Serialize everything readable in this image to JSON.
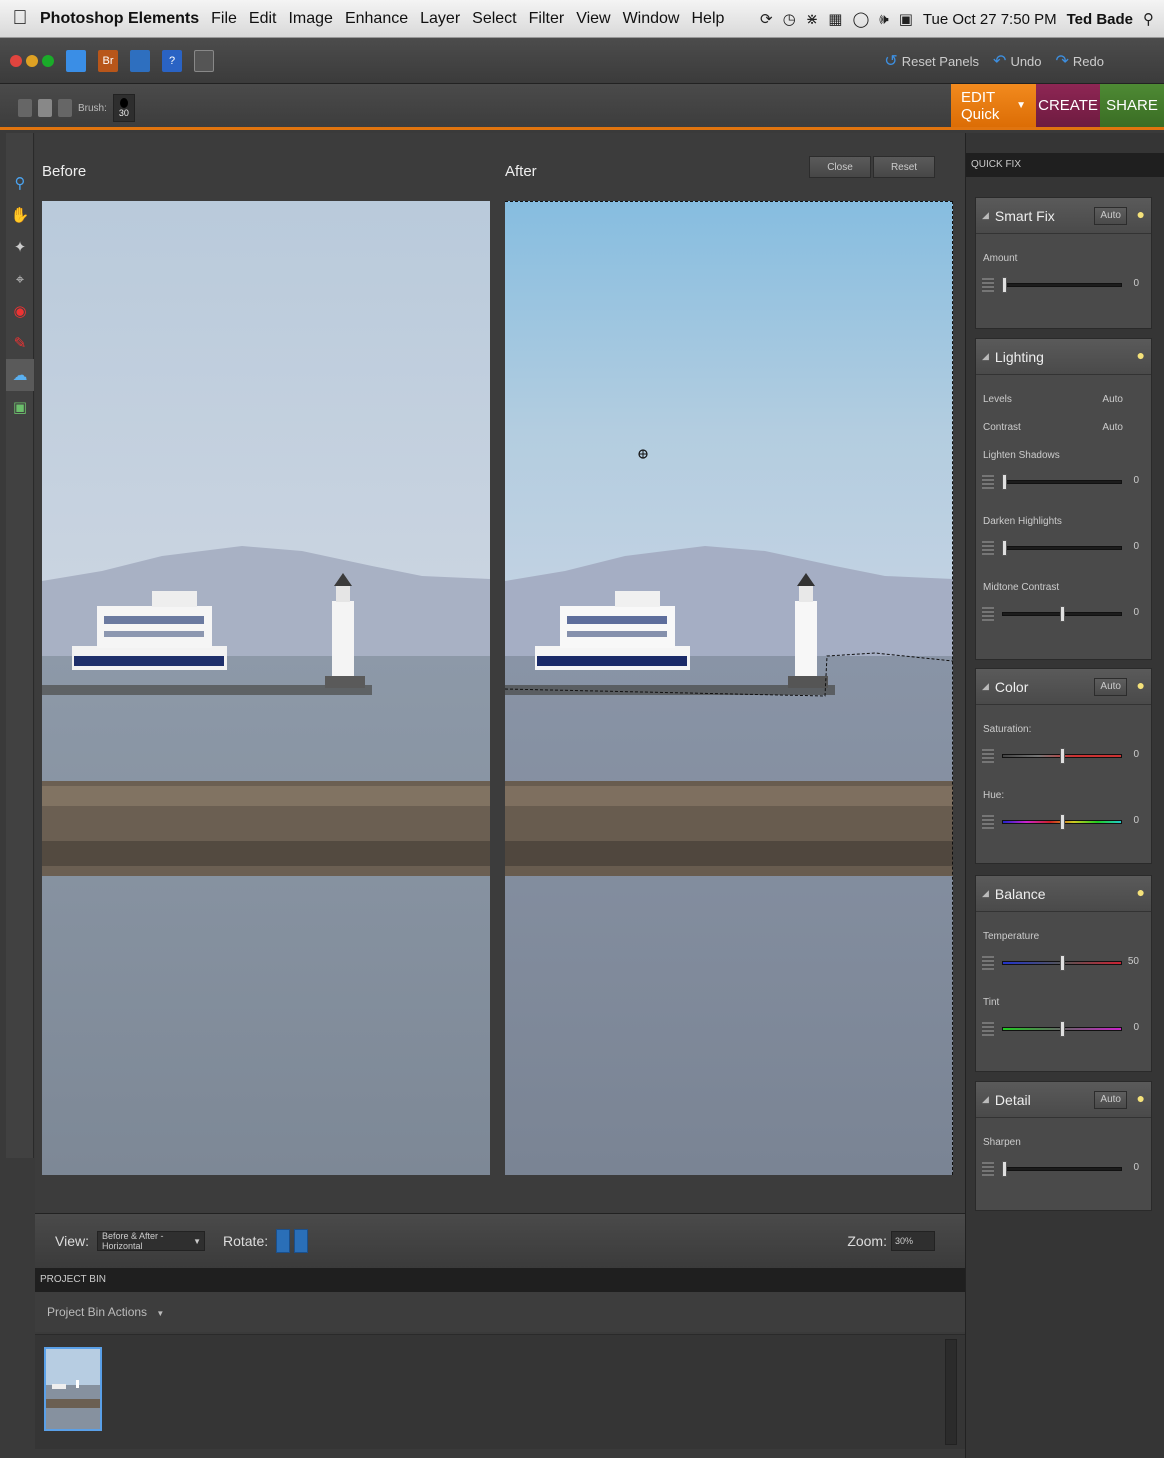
{
  "menubar": {
    "app_name": "Photoshop Elements",
    "menus": [
      "File",
      "Edit",
      "Image",
      "Enhance",
      "Layer",
      "Select",
      "Filter",
      "View",
      "Window",
      "Help"
    ],
    "clock": "Tue Oct 27  7:50 PM",
    "user": "Ted Bade"
  },
  "toolbar": {
    "bridge_label": "Br",
    "help_label": "?",
    "reset_panels": "Reset Panels",
    "undo": "Undo",
    "redo": "Redo"
  },
  "options": {
    "brush_label": "Brush:",
    "brush_size": "30"
  },
  "modes": {
    "edit": "EDIT Quick",
    "create": "CREATE",
    "share": "SHARE"
  },
  "canvas": {
    "before_label": "Before",
    "after_label": "After",
    "close_button": "Close",
    "reset_button": "Reset"
  },
  "viewbar": {
    "view_label": "View:",
    "view_value": "Before & After - Horizontal",
    "rotate_label": "Rotate:",
    "zoom_label": "Zoom:",
    "zoom_value": "30%"
  },
  "project_bin": {
    "header": "PROJECT BIN",
    "actions": "Project Bin Actions"
  },
  "quick_fix": {
    "header": "QUICK FIX",
    "smart_fix": {
      "title": "Smart Fix",
      "auto": "Auto",
      "amount_label": "Amount",
      "amount_value": "0",
      "amount_pos": 0.0
    },
    "lighting": {
      "title": "Lighting",
      "levels_label": "Levels",
      "levels_auto": "Auto",
      "contrast_label": "Contrast",
      "contrast_auto": "Auto",
      "lighten_label": "Lighten Shadows",
      "lighten_value": "0",
      "lighten_pos": 0.0,
      "darken_label": "Darken Highlights",
      "darken_value": "0",
      "darken_pos": 0.0,
      "midtone_label": "Midtone Contrast",
      "midtone_value": "0",
      "midtone_pos": 0.5
    },
    "color": {
      "title": "Color",
      "auto": "Auto",
      "saturation_label": "Saturation:",
      "saturation_value": "0",
      "saturation_pos": 0.5,
      "hue_label": "Hue:",
      "hue_value": "0",
      "hue_pos": 0.5
    },
    "balance": {
      "title": "Balance",
      "temperature_label": "Temperature",
      "temperature_value": "50",
      "temperature_pos": 0.5,
      "tint_label": "Tint",
      "tint_value": "0",
      "tint_pos": 0.5
    },
    "detail": {
      "title": "Detail",
      "auto": "Auto",
      "sharpen_label": "Sharpen",
      "sharpen_value": "0",
      "sharpen_pos": 0.0
    }
  },
  "colors": {
    "edit_tab": "#e67a12",
    "create_tab": "#7e2049",
    "share_tab": "#447a2c",
    "accent_orange": "#e0740f"
  }
}
